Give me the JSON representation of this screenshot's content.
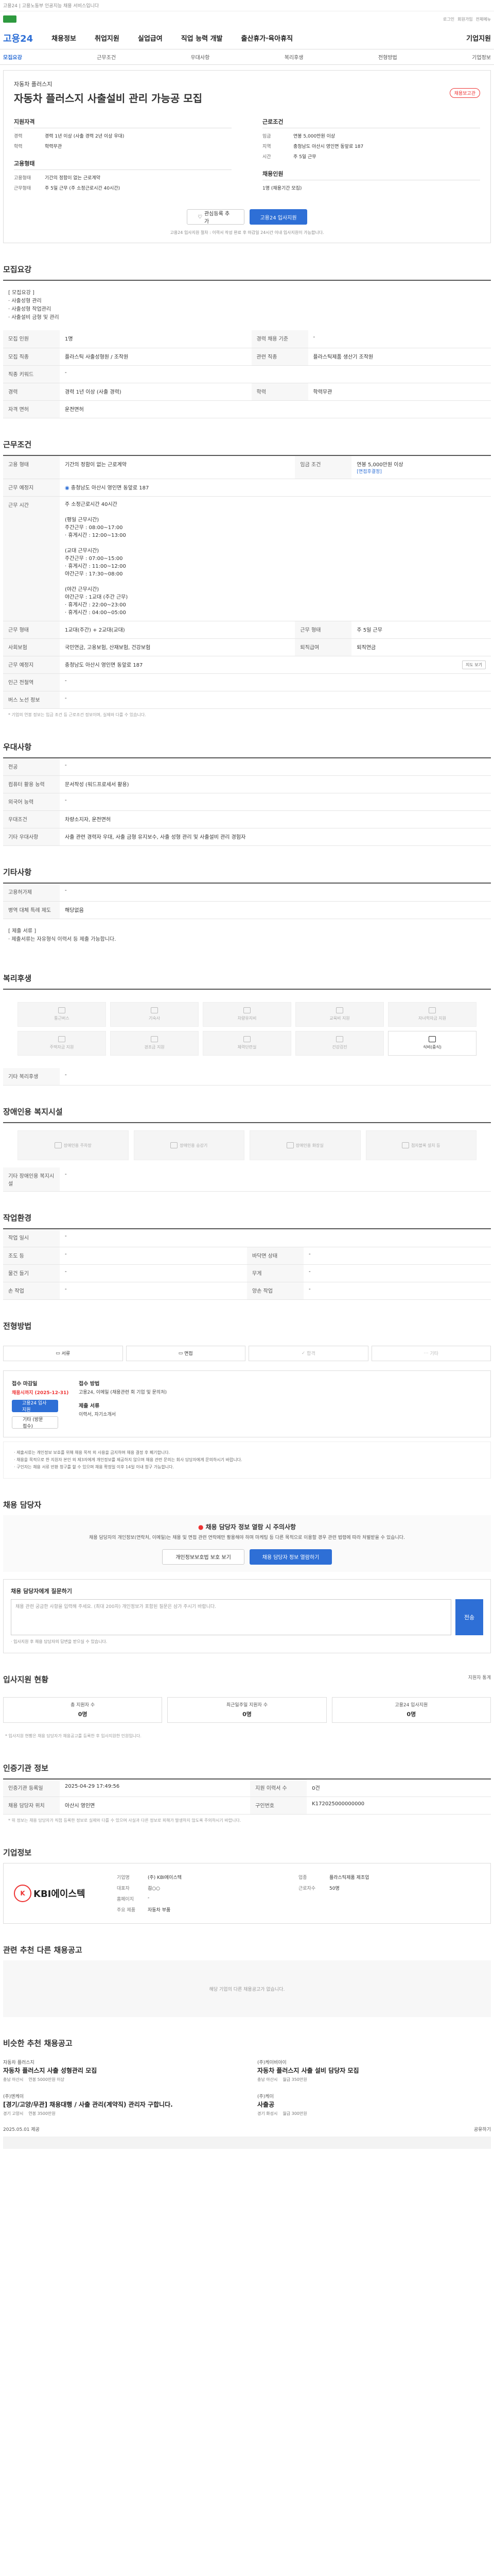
{
  "top": {
    "note": "고용24 | 고용노동부 인공지능 채용 서비스입니다"
  },
  "utility": {
    "items": [
      "로그인",
      "회원가입",
      "전체메뉴"
    ]
  },
  "brand": "고용24",
  "gnb": [
    "채용정보",
    "취업지원",
    "실업급여",
    "직업 능력 개발",
    "출산휴가·육아휴직",
    "기업지원"
  ],
  "subtabs": [
    "모집요강",
    "근무조건",
    "우대사항",
    "복리후생",
    "전형방법",
    "기업정보"
  ],
  "header": {
    "company": "자동차 플러스지",
    "title": "자동차 플러스지 사출설비 관리 가능공 모집",
    "badge": "채용보고관",
    "left_title": "지원자격",
    "left_rows": [
      [
        "경력",
        "경력 1년 이상 (사출 경력 2년 이상 우대)"
      ],
      [
        "학력",
        "학력무관"
      ]
    ],
    "left_title2": "고용형태",
    "left_rows2": [
      [
        "고용형태",
        "기간의 정함이 없는 근로계약"
      ],
      [
        "근무형태",
        "주 5일 근무 (주 소정근로시간 40시간)"
      ]
    ],
    "right_title": "근로조건",
    "right_rows": [
      [
        "임금",
        "연봉 5,000만원 이상"
      ],
      [
        "지역",
        "충청남도 아산시 영인면 동앞로 187"
      ],
      [
        "시간",
        "주 5일 근무"
      ]
    ],
    "right_title2": "채용인원",
    "right_rows2": [
      [
        "",
        "1명 (채용기간 모집)"
      ]
    ],
    "btn_interest": "관심등록 추가",
    "btn_apply": "고용24 입사지원",
    "note": "고용24 입사지원 절차 : 이력서 작성 완료 후 마감일 24시간 이내 입사지원이 가능합니다."
  },
  "recruit": {
    "heading": "모집요강",
    "desc": [
      "[ 모집요강 ]",
      "· 사출성형 관리",
      "· 사출성형 작업관리",
      "· 사출설비 금형 및 관리"
    ],
    "rows": [
      [
        "모집 인원",
        "1명",
        "경력 채용 기준",
        "-"
      ],
      [
        "모집 직종",
        "플라스틱 사출성형원 / 조작원",
        "관련 직종",
        "플라스틱제품 생산기 조작원"
      ],
      [
        "직종 키워드",
        "-",
        "",
        ""
      ],
      [
        "경력",
        "경력 1년 이상 (사출 경력)",
        "학력",
        "학력무관"
      ],
      [
        "자격 면허",
        "운전면허",
        "",
        ""
      ]
    ]
  },
  "cond": {
    "heading": "근무조건",
    "wage_k": "고용 형태",
    "wage_v": "기간의 정함이 없는 근로계약",
    "wage_k2": "임금 조건",
    "wage_v2": "연봉 5,000만원 이상",
    "wage_tag": "[면접후결정]",
    "place_k": "근무 예정지",
    "place_v": "충청남도 아산시 영인면 동앞로 187",
    "time_k": "근무 시간",
    "time_v": [
      "주 소정근로시간 40시간",
      "",
      "(평일 근무시간)",
      "주간근무 : 08:00~17:00",
      "· 휴게시간 : 12:00~13:00",
      "",
      "(교대 근무시간)",
      "주간근무 : 07:00~15:00",
      "· 휴게시간 : 11:00~12:00",
      "야간근무 : 17:30~08:00",
      "",
      "(야간 근무시간)",
      "야간근무 : 1교대 (주간 근무)",
      "· 휴게시간 : 22:00~23:00",
      "· 휴게시간 : 04:00~05:00"
    ],
    "rows": [
      [
        "근무 형태",
        "1교대(주간) + 2교대(교대)",
        "근무 형태",
        "주 5일 근무"
      ],
      [
        "사회보험",
        "국민연금, 고용보험, 산재보험, 건강보험",
        "퇴직급여",
        "퇴직연금"
      ],
      [
        "근무 예정지",
        "충청남도 아산시 영인면 동앞로 187",
        "",
        "지도 보기"
      ],
      [
        "인근 전철역",
        "-",
        "",
        ""
      ],
      [
        "버스 노선 정보",
        "-",
        "",
        ""
      ]
    ],
    "note": "* 기업의 연봉 정보는 임금 조건 등 근로조건 정보이며, 실제와 다를 수 있습니다."
  },
  "pref": {
    "heading": "우대사항",
    "rows": [
      [
        "전공",
        "-"
      ],
      [
        "컴퓨터 활용 능력",
        "문서작성 (워드프로세서 활용)"
      ],
      [
        "외국어 능력",
        "-"
      ],
      [
        "우대조건",
        "차량소지자, 운전면허"
      ],
      [
        "기타 우대사항",
        "사출 관련 경력자 우대, 사출 금형 유지보수, 사출 성형 관리 및 사출설비 관리 경험자"
      ]
    ]
  },
  "etc": {
    "heading": "기타사항",
    "rows": [
      [
        "고용허가제",
        "-"
      ],
      [
        "병역 대체 특례 제도",
        "해당없음"
      ]
    ],
    "extra_title": "[ 제출 서류 ]",
    "extra_text": "· 제출서류는 자유형식 이력서 등 제출 가능합니다."
  },
  "welfare": {
    "heading": "복리후생",
    "items": [
      "통근버스",
      "기숙사",
      "차량유지비",
      "교육비 지원",
      "자녀학자금 지원",
      "주택자금 지원",
      "경조금 지원",
      "체력단련실",
      "건강검진",
      "식비(중식)"
    ],
    "active": 9,
    "sub": "기타 복리후생",
    "sub_v": "-"
  },
  "disability": {
    "heading": "장애인용 복지시설",
    "items": [
      "장애인용 주차장",
      "장애인용 승강기",
      "장애인용 화장실",
      "점자블록 설치 등"
    ],
    "sub": "기타 장애인용 복지시설",
    "sub_v": "-"
  },
  "workenv": {
    "heading": "작업환경",
    "rows": [
      [
        "작업 일시",
        "-",
        "",
        ""
      ],
      [
        "조도 등",
        "-",
        "바닥면 상태",
        "-"
      ],
      [
        "물건 들기",
        "-",
        "무게",
        "-"
      ],
      [
        "손 작업",
        "-",
        "양손 작업",
        "-"
      ]
    ]
  },
  "process": {
    "heading": "전형방법",
    "steps": [
      "서류",
      "면접",
      "합격",
      "기타"
    ],
    "apply_k": "접수 마감일",
    "apply_v": "채용시까지 (2025-12-31)",
    "apply_btn1": "고용24 입사지원",
    "apply_btn2": "기타 (방문 접수)",
    "method_k": "접수 방법",
    "method_v": "고용24, 이메일 (채용관련 회 기업 및 문의처)",
    "doc_k": "제출 서류",
    "doc_v": "이력서, 자기소개서",
    "notes": [
      "· 제출서류는 개인정보 보호를 위해 채용 목적 외 사용을 금지하며 채용 결정 후 폐기합니다.",
      "· 채용을 목적으로 한 지원자 본인 외 제3자에게 개인정보를 제공하지 않으며 채용 관련 문의는 회사 담당자에게 문의하시기 바랍니다.",
      "· 구인자는 채용 서류 반환 청구를 할 수 있으며 채용 확정일 이후 14일 이내 청구 가능합니다."
    ]
  },
  "danger": {
    "heading": "채용 담당자",
    "title": "채용 담당자 정보 열람 시 주의사항",
    "desc": "채용 담당자의 개인정보(연락처, 이메일)는 채용 및 면접 관련 연락에만 활용해야 하며 마케팅 등 다른 목적으로 이용할 경우 관련 법령에 따라 처벌받을 수 있습니다.",
    "btn1": "개인정보보호법 보호 보기",
    "btn2": "채용 담당자 정보 열람하기",
    "report_title": "채용 담당자에게 질문하기",
    "report_ph": "채용 관련 궁금한 사항을 입력해 주세요. (최대 200자) 개인정보가 포함된 질문은 삼가 주시기 바랍니다.",
    "report_btn": "전송",
    "report_foot": "· 입사지원 후 채용 담당자의 답변을 받으실 수 있습니다."
  },
  "stats": {
    "heading": "입사지원 현황",
    "more": "지원자 통계",
    "items": [
      [
        "총 지원자 수",
        "0명"
      ],
      [
        "최근일주일 지원자 수",
        "0명"
      ],
      [
        "고용24 입사지원",
        "0명"
      ]
    ],
    "note": "* 입사지원 현황은 채용 담당자가 채용공고를 등록한 후 입사지원한 인원입니다."
  },
  "info": {
    "heading": "인증기관 정보",
    "rows": [
      [
        "인증기관 등록일",
        "2025-04-29 17:49:56",
        "지원 이력서 수",
        "0건"
      ],
      [
        "채용 담당자 위치",
        "아산시 영인면",
        "구인번호",
        "K172025000000000"
      ]
    ],
    "note": "* 위 정보는 채용 담당자가 직접 등록한 정보로 실제와 다를 수 있으며 사실과 다른 정보로 피해가 발생하지 않도록 주의하시기 바랍니다."
  },
  "corp": {
    "heading": "기업정보",
    "name": "KBI에이스텍",
    "rows": [
      [
        "기업명",
        "(주) KBI에이스텍",
        "업종",
        "플라스틱제품 제조업"
      ],
      [
        "대표자",
        "김○○",
        "근로자수",
        "50명"
      ],
      [
        "홈페이지",
        "-",
        "",
        ""
      ],
      [
        "주요 제품",
        "자동차 부품",
        "",
        ""
      ]
    ]
  },
  "related": {
    "heading": "관련 추천 다른 채용공고",
    "empty": "해당 기업의 다른 채용공고가 없습니다."
  },
  "recommend": {
    "heading": "비슷한 추천 채용공고",
    "jobs": [
      {
        "company": "자동차 플러스지",
        "title": "자동차 플러스지 사출 성형관리 모집",
        "loc": "충남 아산시",
        "pay": "연봉 5000만원 이상"
      },
      {
        "company": "(주)케이비아이",
        "title": "자동차 플러스지 사출 설비 담당자 모집",
        "loc": "충남 아산시",
        "pay": "월급 350만원"
      },
      {
        "company": "(주)엔케이",
        "title": "[경기/고양/무관] 채용대행 / 사출 관리(계약직) 관리자 구합니다.",
        "loc": "경기 고양시",
        "pay": "연봉 3500만원"
      },
      {
        "company": "(주)케이",
        "title": "사출공",
        "loc": "경기 화성시",
        "pay": "월급 300만원"
      }
    ]
  },
  "footer": {
    "left": "2025.05.01 제공",
    "right": "공유하기"
  }
}
